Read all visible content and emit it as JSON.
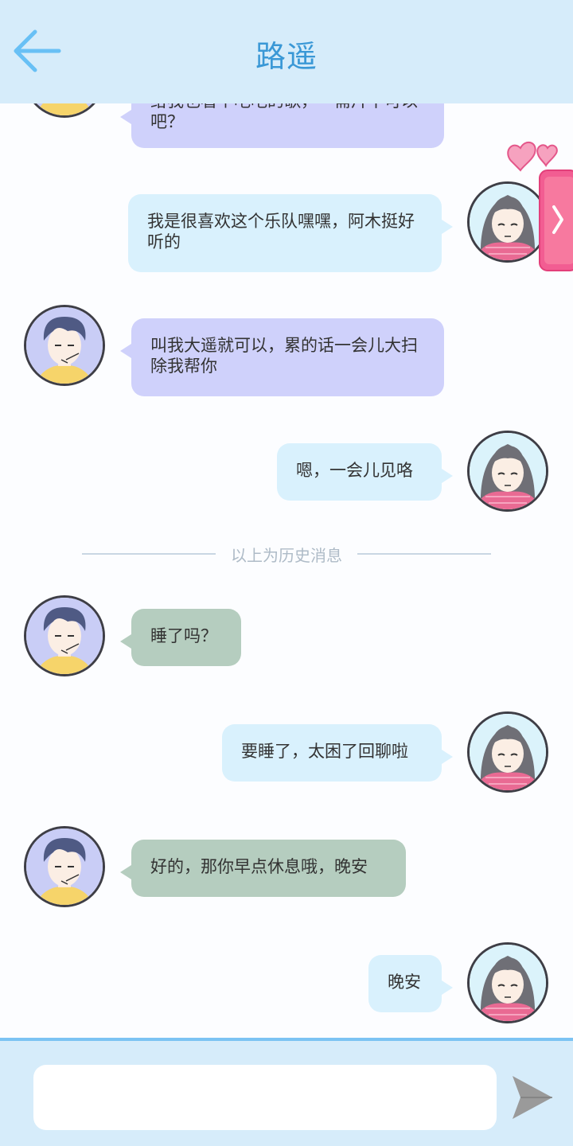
{
  "header": {
    "title": "路遥",
    "back_icon": "arrow-left-icon"
  },
  "messages": [
    {
      "side": "left",
      "text": "给我也看个吧吧的歌，一需片不可以吧？"
    },
    {
      "side": "right",
      "text": "我是很喜欢这个乐队嘿嘿，阿木挺好听的"
    },
    {
      "side": "left",
      "text": "叫我大遥就可以，累的话一会儿大扫除我帮你"
    },
    {
      "side": "right",
      "text": "嗯，一会儿见咯"
    },
    {
      "side": "left",
      "text": "睡了吗？"
    },
    {
      "side": "right",
      "text": "要睡了，太困了回聊啦"
    },
    {
      "side": "left",
      "text": "好的，那你早点休息哦，晚安"
    },
    {
      "side": "right",
      "text": "晚安"
    }
  ],
  "divider_text": "以上为历史消息",
  "side_tab": {
    "icon": "chevron-right-icon",
    "decoration": "hearts-icon"
  },
  "input": {
    "value": "",
    "placeholder": ""
  },
  "send_icon": "send-icon",
  "colors": {
    "header_bg": "#d6ecfa",
    "title": "#3a98d6",
    "bubble_male_history": "#cfd1fb",
    "bubble_female": "#d9f1fd",
    "bubble_male_new": "#b5cdbf",
    "input_bar_border": "#7cc3f3",
    "side_tab": "#f25d92"
  }
}
